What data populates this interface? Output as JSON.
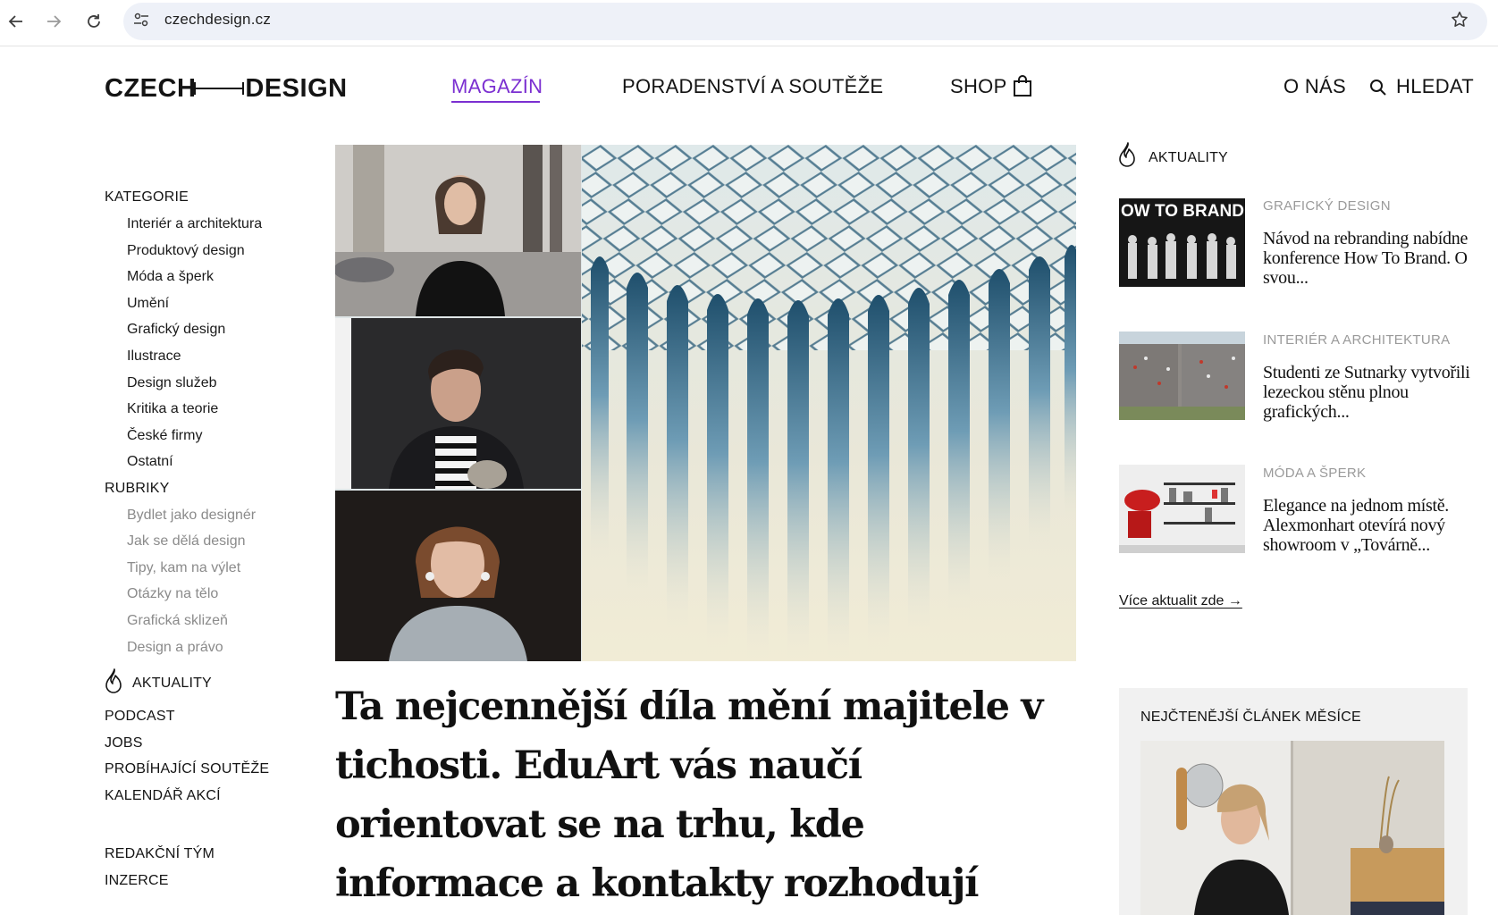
{
  "browser": {
    "url": "czechdesign.cz"
  },
  "site": {
    "logo_left": "CZECH",
    "logo_right": "DESIGN",
    "nav": {
      "magazin": "MAGAZÍN",
      "poradenstvi": "PORADENSTVÍ A SOUTĚŽE",
      "shop": "SHOP",
      "o_nas": "O NÁS",
      "hledat": "HLEDAT"
    },
    "accent_color": "#7b2fd1"
  },
  "sidebar": {
    "kategorie_label": "KATEGORIE",
    "kategorie": [
      "Interiér a architektura",
      "Produktový design",
      "Móda a šperk",
      "Umění",
      "Grafický design",
      "Ilustrace",
      "Design služeb",
      "Kritika a teorie",
      "České firmy",
      "Ostatní"
    ],
    "rubriky_label": "RUBRIKY",
    "rubriky": [
      "Bydlet jako designér",
      "Jak se dělá design",
      "Tipy, kam na výlet",
      "Otázky na tělo",
      "Grafická sklizeň",
      "Design a právo"
    ],
    "aktuality": "AKTUALITY",
    "links": [
      "PODCAST",
      "JOBS",
      "PROBÍHAJÍCÍ SOUTĚŽE",
      "KALENDÁŘ AKCÍ"
    ],
    "bottom_links": [
      "REDAKČNÍ TÝM",
      "INZERCE"
    ]
  },
  "main": {
    "headline": "Ta nejcennější díla mění majitele v tichosti. EduArt vás naučí orientovat se na trhu, kde informace a kontakty rozhodují"
  },
  "news": {
    "heading": "AKTUALITY",
    "items": [
      {
        "category": "GRAFICKÝ DESIGN",
        "title": "Návod na rebranding nabídne konference How To Brand. O svou...",
        "thumb_text": "OW TO BRAND"
      },
      {
        "category": "INTERIÉR A ARCHITEKTURA",
        "title": "Studenti ze Sutnarky vytvořili lezeckou stěnu plnou grafických..."
      },
      {
        "category": "MÓDA A ŠPERK",
        "title": "Elegance na jednom místě. Alexmonhart otevírá nový showroom v „Továrně..."
      }
    ],
    "more_link": "Více aktualit zde →"
  },
  "most_read": {
    "title": "NEJČTENĚJŠÍ ČLÁNEK MĚSÍCE"
  }
}
